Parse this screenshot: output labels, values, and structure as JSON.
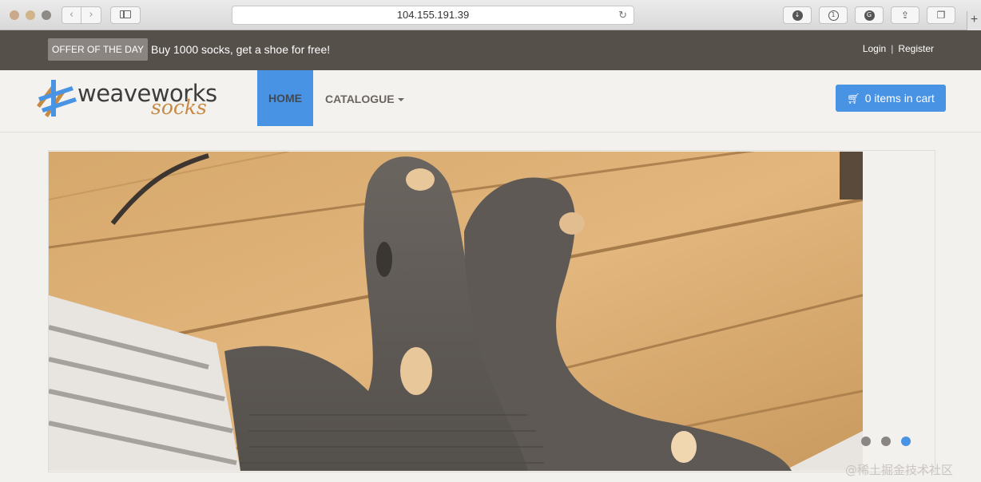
{
  "browser": {
    "url": "104.155.191.39",
    "back_glyph": "‹",
    "forward_glyph": "›",
    "reload_glyph": "↻",
    "newtab_glyph": "+",
    "icons": [
      "sidebar-icon",
      "download-icon",
      "1password-icon",
      "grammarly-icon",
      "share-icon",
      "tabs-icon"
    ]
  },
  "topbar": {
    "offer_badge": "OFFER OF THE DAY",
    "offer_text": "Buy 1000 socks, get a shoe for free!",
    "login": "Login",
    "separator": "|",
    "register": "Register"
  },
  "navbar": {
    "logo_word": "weaveworks",
    "logo_sub": "socks",
    "home": "HOME",
    "catalogue": "CATALOGUE",
    "cart": "0 items in cart",
    "active_color": "#4993e4"
  },
  "hero": {
    "slides": 3,
    "active_slide": 3,
    "image": "worn-grey-socks-on-wooden-floor"
  },
  "watermark": "@稀土掘金技术社区",
  "colors": {
    "topbar_bg": "#56504b",
    "accent_blue": "#4993e4",
    "logo_orange": "#c68a45"
  }
}
